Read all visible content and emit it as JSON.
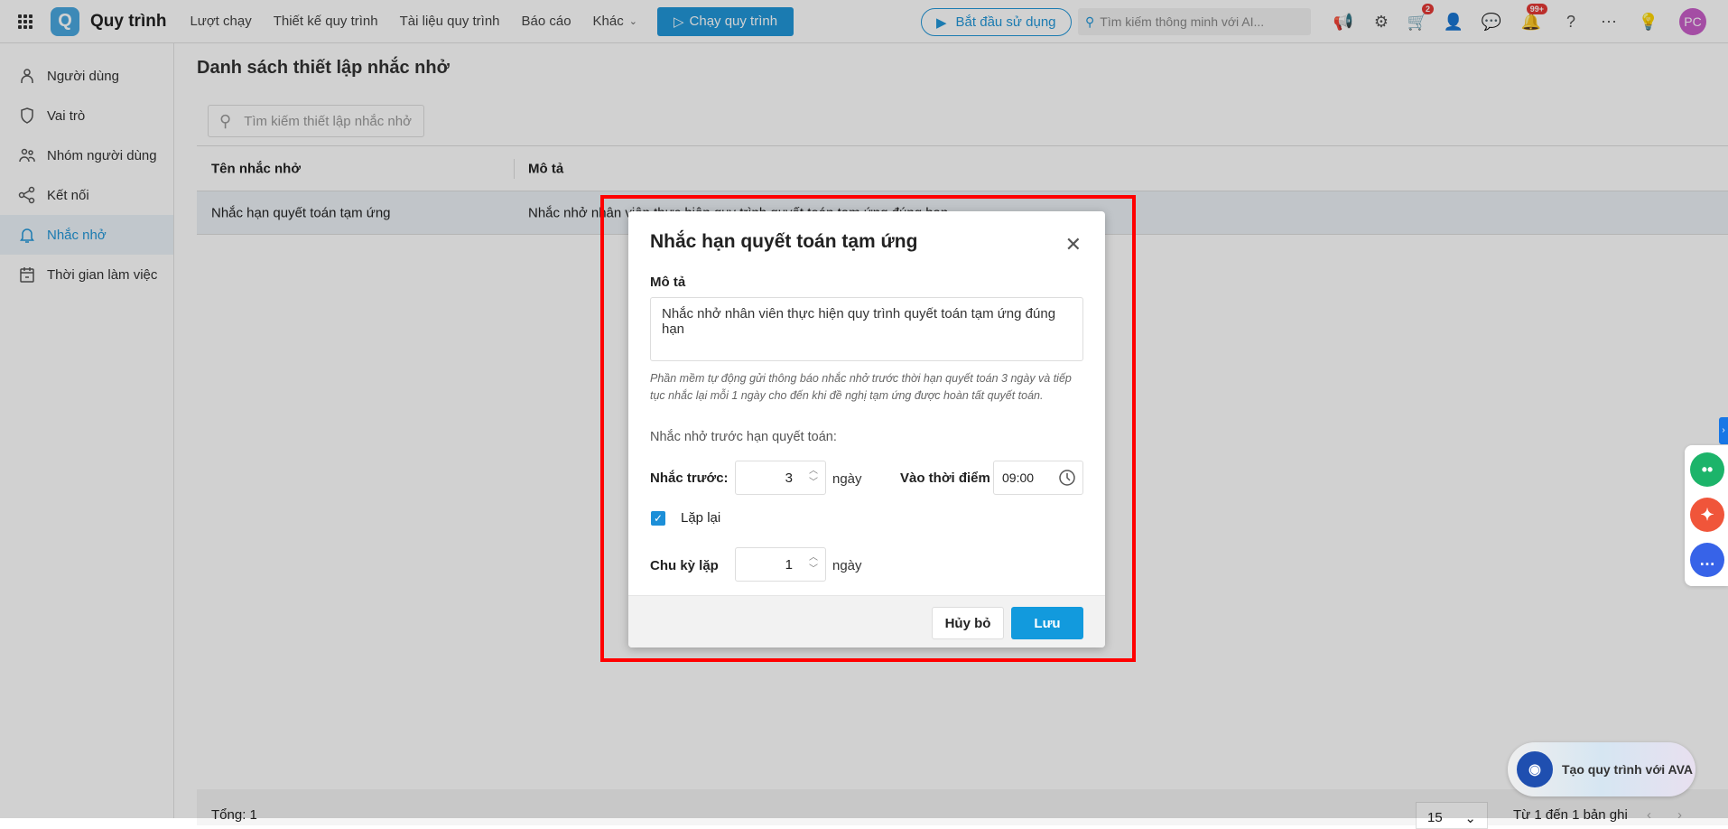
{
  "topbar": {
    "app_name": "Quy trình",
    "nav": [
      "Lượt chạy",
      "Thiết kế quy trình",
      "Tài liệu quy trình",
      "Báo cáo",
      "Khác"
    ],
    "run_button": "Chạy quy trình",
    "start_button": "Bắt đầu sử dụng",
    "ai_search_placeholder": "Tìm kiếm thông minh với AI...",
    "cart_badge": "2",
    "notif_badge": "99+",
    "avatar": "PC"
  },
  "sidebar": {
    "items": [
      {
        "label": "Người dùng"
      },
      {
        "label": "Vai trò"
      },
      {
        "label": "Nhóm người dùng"
      },
      {
        "label": "Kết nối"
      },
      {
        "label": "Nhắc nhở"
      },
      {
        "label": "Thời gian làm việc"
      }
    ]
  },
  "main": {
    "title": "Danh sách thiết lập nhắc nhở",
    "search_placeholder": "Tìm kiếm thiết lập nhắc nhở",
    "columns": [
      "Tên nhắc nhở",
      "Mô tả"
    ],
    "rows": [
      {
        "name": "Nhắc hạn quyết toán tạm ứng",
        "desc": "Nhắc nhở nhân viên thực hiện quy trình quyết toán tạm ứng đúng hạn"
      }
    ],
    "footer": {
      "total": "Tổng: 1",
      "page_size": "15",
      "range": "Từ 1 đến 1 bản ghi"
    }
  },
  "ava": {
    "label": "Tạo quy trình với AVA"
  },
  "modal": {
    "title": "Nhắc hạn quyết toán tạm ứng",
    "desc_label": "Mô tả",
    "desc_value": "Nhắc nhở nhân viên thực hiện quy trình quyết toán tạm ứng đúng hạn",
    "hint": "Phần mềm tự động gửi thông báo nhắc nhở trước thời hạn quyết toán 3 ngày và tiếp tục nhắc lại mỗi 1 ngày cho đến khi đề nghị tạm ứng được hoàn tất quyết toán.",
    "section": "Nhắc nhở trước hạn quyết toán:",
    "remind_label": "Nhắc trước:",
    "remind_value": "3",
    "unit": "ngày",
    "time_label": "Vào thời điểm",
    "time_value": "09:00",
    "repeat_label": "Lặp lại",
    "repeat_checked": true,
    "cycle_label": "Chu kỳ lặp",
    "cycle_value": "1",
    "cancel": "Hủy bỏ",
    "save": "Lưu"
  }
}
